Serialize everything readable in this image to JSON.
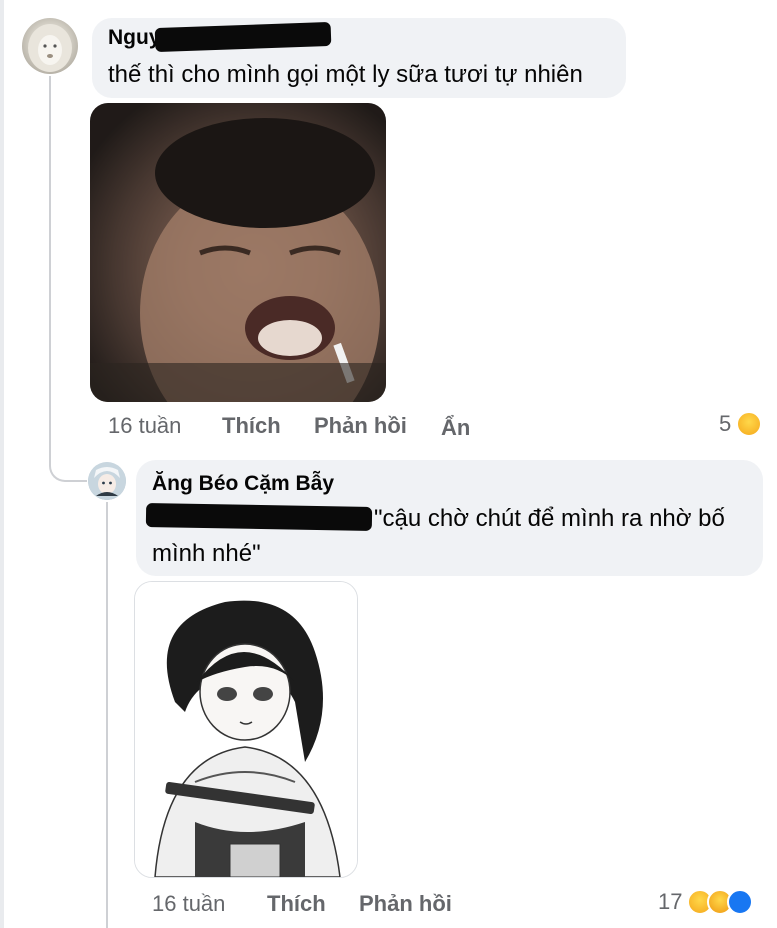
{
  "comments": [
    {
      "author": "Nguy",
      "text": "thế thì cho mình gọi một ly sữa tươi tự nhiên",
      "time": "16 tuần",
      "like": "Thích",
      "reply": "Phản hồi",
      "hide": "Ẩn",
      "reaction_count": "5",
      "reactions": [
        "haha-emoji-icon"
      ]
    },
    {
      "author": "Ăng Béo Cặm Bẫy",
      "text_quote_start": "\"cậu chờ chút để mình ra nhờ bố",
      "text_quote_end": "mình nhé\"",
      "time": "16 tuần",
      "like": "Thích",
      "reply": "Phản hồi",
      "reaction_count": "17",
      "reactions": [
        "haha-emoji-icon",
        "sad-emoji-icon",
        "like-icon"
      ]
    }
  ],
  "colors": {
    "bubble": "#f0f2f5",
    "meta_text": "#65676b",
    "thread_line": "#ced0d4",
    "like_blue": "#1877f2"
  }
}
